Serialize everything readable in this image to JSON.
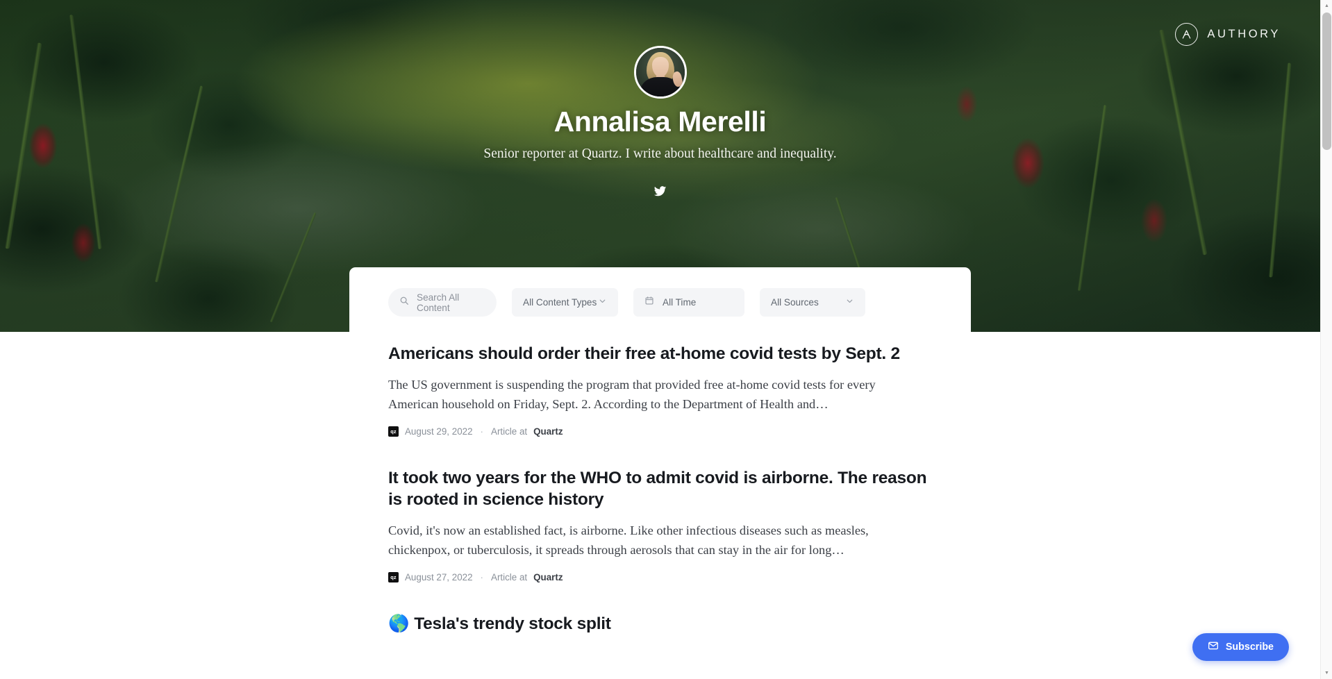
{
  "brand": {
    "name": "AUTHORY",
    "mark_icon": "authory-logo-icon"
  },
  "hero": {
    "name": "Annalisa Merelli",
    "tagline": "Senior reporter at Quartz. I write about healthcare and inequality.",
    "avatar_alt": "Annalisa Merelli profile photo",
    "social": [
      {
        "label": "Twitter",
        "icon": "twitter-icon"
      }
    ]
  },
  "filters": {
    "search": {
      "placeholder": "Search All Content",
      "value": "",
      "icon": "search-icon"
    },
    "content_type": {
      "label": "All Content Types",
      "icon": "chevron-down-icon"
    },
    "time": {
      "label": "All Time",
      "icon": "calendar-icon"
    },
    "source": {
      "label": "All Sources",
      "icon": "chevron-down-icon"
    }
  },
  "articles": [
    {
      "title": "Americans should order their free at-home covid tests by Sept. 2",
      "emoji": "",
      "excerpt": "The US government is suspending the program that provided free at-home covid tests for every American household on Friday, Sept. 2. According to the Department of Health and…",
      "favicon_text": "qz",
      "date": "August 29, 2022",
      "separator": "·",
      "type_label": "Article at",
      "source": "Quartz"
    },
    {
      "title": "It took two years for the WHO to admit covid is airborne. The reason is rooted in science history",
      "emoji": "",
      "excerpt": "Covid, it's now an established fact, is airborne. Like other infectious diseases such as measles, chickenpox, or tuberculosis, it spreads through aerosols that can stay in the air for long…",
      "favicon_text": "qz",
      "date": "August 27, 2022",
      "separator": "·",
      "type_label": "Article at",
      "source": "Quartz"
    },
    {
      "title": "Tesla's trendy stock split",
      "emoji": "🌎",
      "excerpt": "",
      "favicon_text": "",
      "date": "",
      "separator": "",
      "type_label": "",
      "source": ""
    }
  ],
  "subscribe": {
    "label": "Subscribe",
    "icon": "envelope-icon",
    "color": "#3f6ff2"
  },
  "scrollbar": {
    "up_icon": "caret-up-icon",
    "down_icon": "caret-down-icon"
  }
}
